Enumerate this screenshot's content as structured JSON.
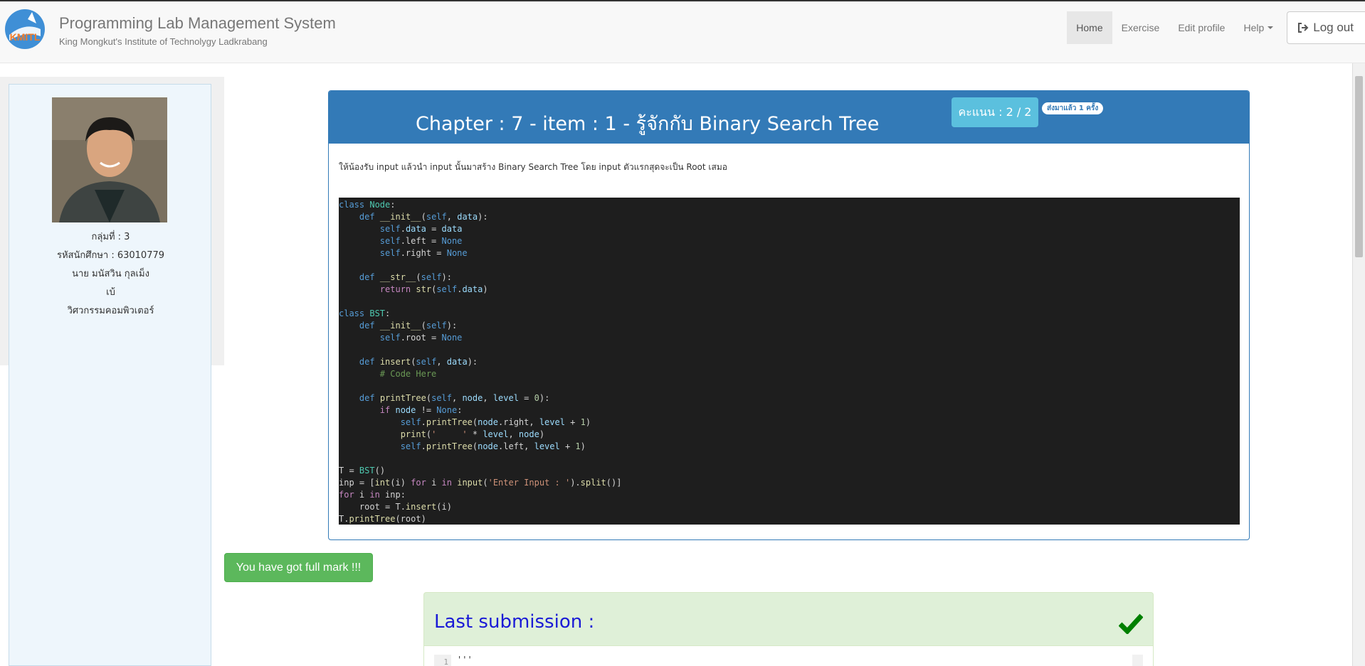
{
  "header": {
    "title": "Programming Lab Management System",
    "subtitle": "King Mongkut's Institute of Technolygy Ladkrabang",
    "logo_text": "KMITL",
    "nav": [
      {
        "label": "Home",
        "active": true
      },
      {
        "label": "Exercise"
      },
      {
        "label": "Edit profile"
      },
      {
        "label": "Help"
      }
    ],
    "logout_label": "Log out"
  },
  "profile": {
    "group": "กลุ่มที่ : 3",
    "student_id": "รหัสนักศึกษา : 63010779",
    "name": "นาย มนัสวิน กุลเม็ง",
    "nickname": "เบ้",
    "department": "วิศวกรรมคอมพิวเตอร์"
  },
  "exercise": {
    "title": "Chapter : 7 - item : 1 - รู้จักกับ Binary Search Tree",
    "score": "คะแนน : 2 / 2",
    "sent_badge": "ส่งมาแล้ว 1 ครั้ง",
    "instruction": "ให้น้องรับ input แล้วนำ input นั้นมาสร้าง Binary Search Tree โดย input ตัวแรกสุดจะเป็น Root เสมอ",
    "code_lines": [
      "class Node:",
      "    def __init__(self, data):",
      "        self.data = data",
      "        self.left = None",
      "        self.right = None",
      "",
      "    def __str__(self):",
      "        return str(self.data)",
      "",
      "class BST:",
      "    def __init__(self):",
      "        self.root = None",
      "",
      "    def insert(self, data):",
      "        # Code Here",
      "",
      "    def printTree(self, node, level = 0):",
      "        if node != None:",
      "            self.printTree(node.right, level + 1)",
      "            print('     ' * level, node)",
      "            self.printTree(node.left, level + 1)",
      "",
      "T = BST()",
      "inp = [int(i) for i in input('Enter Input : ').split()]",
      "for i in inp:",
      "    root = T.insert(i)",
      "T.printTree(root)"
    ]
  },
  "feedback": {
    "full_mark": "You have got full mark !!!"
  },
  "last_submission": {
    "title": "Last submission :",
    "line_number": "1",
    "first_line": "'''"
  },
  "colors": {
    "primary": "#337ab7",
    "info": "#5bc0de",
    "success": "#5cb85c",
    "success_bg": "#dff0d8",
    "check": "#008000"
  }
}
